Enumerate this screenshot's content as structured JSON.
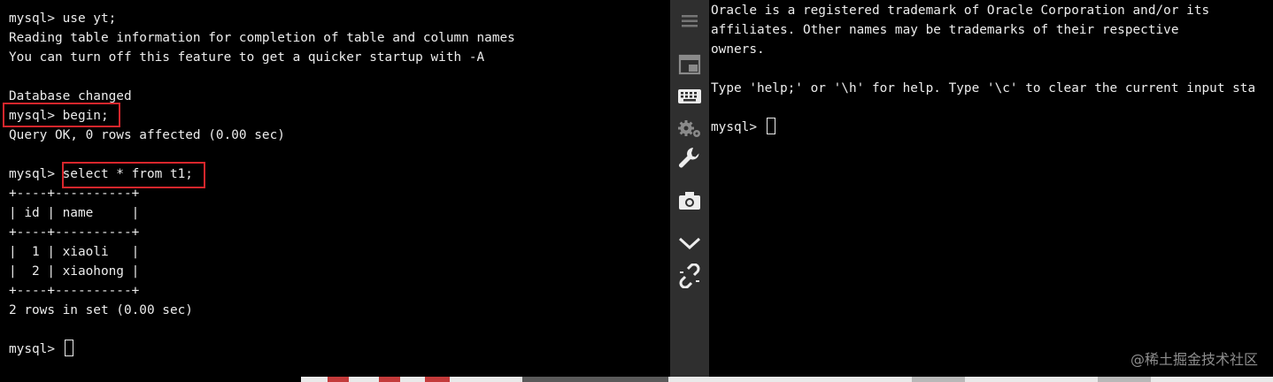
{
  "left_terminal": {
    "lines": [
      "mysql> use yt;",
      "Reading table information for completion of table and column names",
      "You can turn off this feature to get a quicker startup with -A",
      "",
      "Database changed",
      "mysql> begin;",
      "Query OK, 0 rows affected (0.00 sec)",
      "",
      "mysql> select * from t1;",
      "+----+----------+",
      "| id | name     |",
      "+----+----------+",
      "|  1 | xiaoli   |",
      "|  2 | xiaohong |",
      "+----+----------+",
      "2 rows in set (0.00 sec)",
      "",
      "mysql> "
    ]
  },
  "right_terminal": {
    "lines": [
      "Oracle is a registered trademark of Oracle Corporation and/or its",
      "affiliates. Other names may be trademarks of their respective",
      "owners.",
      "",
      "Type 'help;' or '\\h' for help. Type '\\c' to clear the current input sta",
      "",
      "mysql> "
    ]
  },
  "sidebar": {
    "icons": [
      "menu-icon",
      "window-icon",
      "keyboard-icon",
      "settings-icon",
      "wrench-icon",
      "camera-icon",
      "chevron-down-icon",
      "link-icon"
    ]
  },
  "watermark": "@稀土掘金技术社区",
  "colors": {
    "highlight": "#d8262c",
    "sidebar_bg": "#2f2f2f",
    "terminal_bg": "#000000",
    "terminal_fg": "#ececec"
  }
}
